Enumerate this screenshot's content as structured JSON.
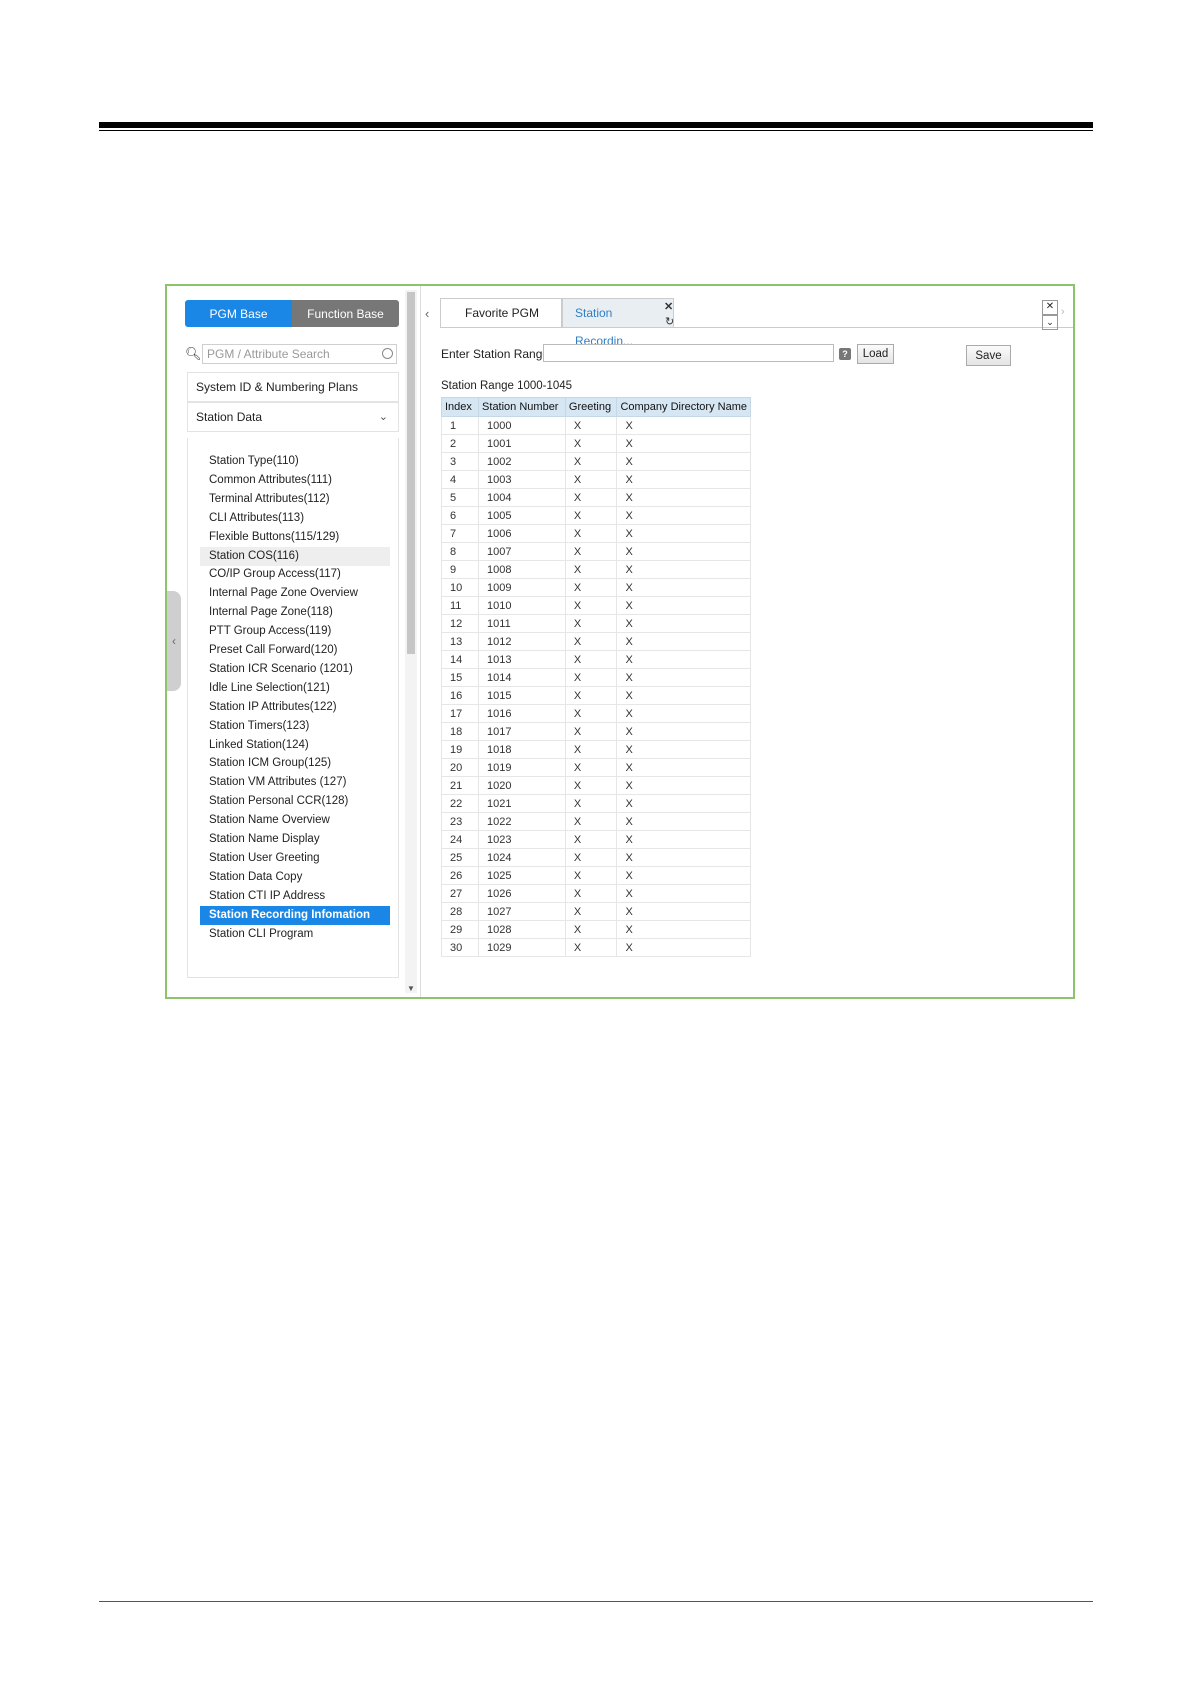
{
  "sidebar": {
    "pgm_base": "PGM Base",
    "function_base": "Function Base",
    "search_placeholder": "PGM / Attribute Search",
    "sections": [
      "System ID & Numbering Plans",
      "Station Data"
    ],
    "items": [
      {
        "label": "Station Type(110)"
      },
      {
        "label": "Common Attributes(111)"
      },
      {
        "label": "Terminal Attributes(112)"
      },
      {
        "label": "CLI Attributes(113)"
      },
      {
        "label": "Flexible Buttons(115/129)"
      },
      {
        "label": "Station COS(116)",
        "state": "hover"
      },
      {
        "label": "CO/IP Group Access(117)"
      },
      {
        "label": "Internal Page Zone Overview"
      },
      {
        "label": "Internal Page Zone(118)"
      },
      {
        "label": "PTT Group Access(119)"
      },
      {
        "label": "Preset Call Forward(120)"
      },
      {
        "label": "Station ICR Scenario (1201)"
      },
      {
        "label": "Idle Line Selection(121)"
      },
      {
        "label": "Station IP Attributes(122)"
      },
      {
        "label": "Station Timers(123)"
      },
      {
        "label": "Linked Station(124)"
      },
      {
        "label": "Station ICM Group(125)"
      },
      {
        "label": "Station VM Attributes (127)"
      },
      {
        "label": "Station Personal CCR(128)"
      },
      {
        "label": "Station Name Overview"
      },
      {
        "label": "Station Name Display"
      },
      {
        "label": "Station User Greeting"
      },
      {
        "label": "Station Data Copy"
      },
      {
        "label": "Station CTI IP Address"
      },
      {
        "label": "Station Recording Infomation",
        "state": "active"
      },
      {
        "label": "Station CLI Program"
      }
    ]
  },
  "tabs": {
    "favorite": "Favorite PGM",
    "current": "Station Recordin..."
  },
  "form": {
    "range_label": "Enter Station Range :",
    "range_value": "",
    "load": "Load",
    "save": "Save",
    "range_text": "Station Range 1000-1045"
  },
  "table": {
    "headers": [
      "Index",
      "Station Number",
      "Greeting",
      "Company Directory Name"
    ],
    "rows": [
      [
        "1",
        "1000",
        "X",
        "X"
      ],
      [
        "2",
        "1001",
        "X",
        "X"
      ],
      [
        "3",
        "1002",
        "X",
        "X"
      ],
      [
        "4",
        "1003",
        "X",
        "X"
      ],
      [
        "5",
        "1004",
        "X",
        "X"
      ],
      [
        "6",
        "1005",
        "X",
        "X"
      ],
      [
        "7",
        "1006",
        "X",
        "X"
      ],
      [
        "8",
        "1007",
        "X",
        "X"
      ],
      [
        "9",
        "1008",
        "X",
        "X"
      ],
      [
        "10",
        "1009",
        "X",
        "X"
      ],
      [
        "11",
        "1010",
        "X",
        "X"
      ],
      [
        "12",
        "1011",
        "X",
        "X"
      ],
      [
        "13",
        "1012",
        "X",
        "X"
      ],
      [
        "14",
        "1013",
        "X",
        "X"
      ],
      [
        "15",
        "1014",
        "X",
        "X"
      ],
      [
        "16",
        "1015",
        "X",
        "X"
      ],
      [
        "17",
        "1016",
        "X",
        "X"
      ],
      [
        "18",
        "1017",
        "X",
        "X"
      ],
      [
        "19",
        "1018",
        "X",
        "X"
      ],
      [
        "20",
        "1019",
        "X",
        "X"
      ],
      [
        "21",
        "1020",
        "X",
        "X"
      ],
      [
        "22",
        "1021",
        "X",
        "X"
      ],
      [
        "23",
        "1022",
        "X",
        "X"
      ],
      [
        "24",
        "1023",
        "X",
        "X"
      ],
      [
        "25",
        "1024",
        "X",
        "X"
      ],
      [
        "26",
        "1025",
        "X",
        "X"
      ],
      [
        "27",
        "1026",
        "X",
        "X"
      ],
      [
        "28",
        "1027",
        "X",
        "X"
      ],
      [
        "29",
        "1028",
        "X",
        "X"
      ],
      [
        "30",
        "1029",
        "X",
        "X"
      ]
    ]
  },
  "colors": {
    "frame_border": "#8dc36b",
    "accent": "#1a87e6",
    "function_base_bg": "#777777",
    "table_header": "#d6e6f3"
  },
  "icons": [
    "search-icon",
    "clear-icon",
    "chevron-down-icon",
    "collapse-handle-icon",
    "tab-prev-icon",
    "tab-close-icon",
    "refresh-icon",
    "window-close-icon",
    "window-menu-icon",
    "tab-next-icon",
    "help-icon"
  ]
}
